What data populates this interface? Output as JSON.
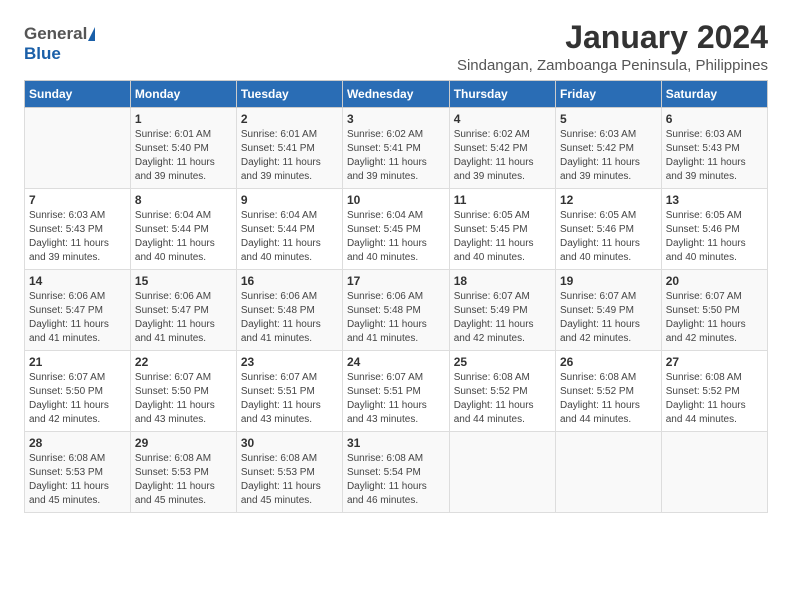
{
  "logo": {
    "general": "General",
    "blue": "Blue"
  },
  "title": "January 2024",
  "subtitle": "Sindangan, Zamboanga Peninsula, Philippines",
  "days": [
    "Sunday",
    "Monday",
    "Tuesday",
    "Wednesday",
    "Thursday",
    "Friday",
    "Saturday"
  ],
  "weeks": [
    [
      {
        "num": "",
        "sunrise": "",
        "sunset": "",
        "daylight": ""
      },
      {
        "num": "1",
        "sunrise": "Sunrise: 6:01 AM",
        "sunset": "Sunset: 5:40 PM",
        "daylight": "Daylight: 11 hours and 39 minutes."
      },
      {
        "num": "2",
        "sunrise": "Sunrise: 6:01 AM",
        "sunset": "Sunset: 5:41 PM",
        "daylight": "Daylight: 11 hours and 39 minutes."
      },
      {
        "num": "3",
        "sunrise": "Sunrise: 6:02 AM",
        "sunset": "Sunset: 5:41 PM",
        "daylight": "Daylight: 11 hours and 39 minutes."
      },
      {
        "num": "4",
        "sunrise": "Sunrise: 6:02 AM",
        "sunset": "Sunset: 5:42 PM",
        "daylight": "Daylight: 11 hours and 39 minutes."
      },
      {
        "num": "5",
        "sunrise": "Sunrise: 6:03 AM",
        "sunset": "Sunset: 5:42 PM",
        "daylight": "Daylight: 11 hours and 39 minutes."
      },
      {
        "num": "6",
        "sunrise": "Sunrise: 6:03 AM",
        "sunset": "Sunset: 5:43 PM",
        "daylight": "Daylight: 11 hours and 39 minutes."
      }
    ],
    [
      {
        "num": "7",
        "sunrise": "Sunrise: 6:03 AM",
        "sunset": "Sunset: 5:43 PM",
        "daylight": "Daylight: 11 hours and 39 minutes."
      },
      {
        "num": "8",
        "sunrise": "Sunrise: 6:04 AM",
        "sunset": "Sunset: 5:44 PM",
        "daylight": "Daylight: 11 hours and 40 minutes."
      },
      {
        "num": "9",
        "sunrise": "Sunrise: 6:04 AM",
        "sunset": "Sunset: 5:44 PM",
        "daylight": "Daylight: 11 hours and 40 minutes."
      },
      {
        "num": "10",
        "sunrise": "Sunrise: 6:04 AM",
        "sunset": "Sunset: 5:45 PM",
        "daylight": "Daylight: 11 hours and 40 minutes."
      },
      {
        "num": "11",
        "sunrise": "Sunrise: 6:05 AM",
        "sunset": "Sunset: 5:45 PM",
        "daylight": "Daylight: 11 hours and 40 minutes."
      },
      {
        "num": "12",
        "sunrise": "Sunrise: 6:05 AM",
        "sunset": "Sunset: 5:46 PM",
        "daylight": "Daylight: 11 hours and 40 minutes."
      },
      {
        "num": "13",
        "sunrise": "Sunrise: 6:05 AM",
        "sunset": "Sunset: 5:46 PM",
        "daylight": "Daylight: 11 hours and 40 minutes."
      }
    ],
    [
      {
        "num": "14",
        "sunrise": "Sunrise: 6:06 AM",
        "sunset": "Sunset: 5:47 PM",
        "daylight": "Daylight: 11 hours and 41 minutes."
      },
      {
        "num": "15",
        "sunrise": "Sunrise: 6:06 AM",
        "sunset": "Sunset: 5:47 PM",
        "daylight": "Daylight: 11 hours and 41 minutes."
      },
      {
        "num": "16",
        "sunrise": "Sunrise: 6:06 AM",
        "sunset": "Sunset: 5:48 PM",
        "daylight": "Daylight: 11 hours and 41 minutes."
      },
      {
        "num": "17",
        "sunrise": "Sunrise: 6:06 AM",
        "sunset": "Sunset: 5:48 PM",
        "daylight": "Daylight: 11 hours and 41 minutes."
      },
      {
        "num": "18",
        "sunrise": "Sunrise: 6:07 AM",
        "sunset": "Sunset: 5:49 PM",
        "daylight": "Daylight: 11 hours and 42 minutes."
      },
      {
        "num": "19",
        "sunrise": "Sunrise: 6:07 AM",
        "sunset": "Sunset: 5:49 PM",
        "daylight": "Daylight: 11 hours and 42 minutes."
      },
      {
        "num": "20",
        "sunrise": "Sunrise: 6:07 AM",
        "sunset": "Sunset: 5:50 PM",
        "daylight": "Daylight: 11 hours and 42 minutes."
      }
    ],
    [
      {
        "num": "21",
        "sunrise": "Sunrise: 6:07 AM",
        "sunset": "Sunset: 5:50 PM",
        "daylight": "Daylight: 11 hours and 42 minutes."
      },
      {
        "num": "22",
        "sunrise": "Sunrise: 6:07 AM",
        "sunset": "Sunset: 5:50 PM",
        "daylight": "Daylight: 11 hours and 43 minutes."
      },
      {
        "num": "23",
        "sunrise": "Sunrise: 6:07 AM",
        "sunset": "Sunset: 5:51 PM",
        "daylight": "Daylight: 11 hours and 43 minutes."
      },
      {
        "num": "24",
        "sunrise": "Sunrise: 6:07 AM",
        "sunset": "Sunset: 5:51 PM",
        "daylight": "Daylight: 11 hours and 43 minutes."
      },
      {
        "num": "25",
        "sunrise": "Sunrise: 6:08 AM",
        "sunset": "Sunset: 5:52 PM",
        "daylight": "Daylight: 11 hours and 44 minutes."
      },
      {
        "num": "26",
        "sunrise": "Sunrise: 6:08 AM",
        "sunset": "Sunset: 5:52 PM",
        "daylight": "Daylight: 11 hours and 44 minutes."
      },
      {
        "num": "27",
        "sunrise": "Sunrise: 6:08 AM",
        "sunset": "Sunset: 5:52 PM",
        "daylight": "Daylight: 11 hours and 44 minutes."
      }
    ],
    [
      {
        "num": "28",
        "sunrise": "Sunrise: 6:08 AM",
        "sunset": "Sunset: 5:53 PM",
        "daylight": "Daylight: 11 hours and 45 minutes."
      },
      {
        "num": "29",
        "sunrise": "Sunrise: 6:08 AM",
        "sunset": "Sunset: 5:53 PM",
        "daylight": "Daylight: 11 hours and 45 minutes."
      },
      {
        "num": "30",
        "sunrise": "Sunrise: 6:08 AM",
        "sunset": "Sunset: 5:53 PM",
        "daylight": "Daylight: 11 hours and 45 minutes."
      },
      {
        "num": "31",
        "sunrise": "Sunrise: 6:08 AM",
        "sunset": "Sunset: 5:54 PM",
        "daylight": "Daylight: 11 hours and 46 minutes."
      },
      {
        "num": "",
        "sunrise": "",
        "sunset": "",
        "daylight": ""
      },
      {
        "num": "",
        "sunrise": "",
        "sunset": "",
        "daylight": ""
      },
      {
        "num": "",
        "sunrise": "",
        "sunset": "",
        "daylight": ""
      }
    ]
  ]
}
